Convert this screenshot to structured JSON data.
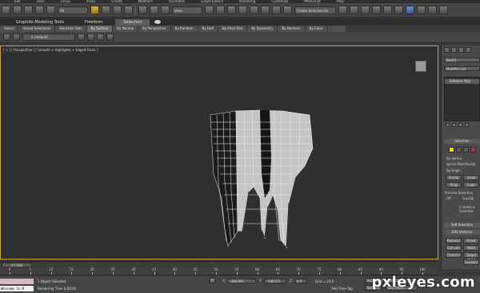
{
  "menu": [
    "Edit",
    "Tools",
    "Group",
    "Views",
    "Create",
    "Modifiers",
    "Animation",
    "Graph Editors",
    "Rendering",
    "Customize",
    "MAXScript",
    "Help"
  ],
  "toolbar": {
    "view_dropdown": "View",
    "selection_set": "Create Selection Se"
  },
  "ribbon": {
    "tabs": [
      "Graphite Modeling Tools",
      "Freeform",
      "Selection"
    ],
    "active_tab": 2,
    "buttons": [
      "Select",
      "Stored Selections",
      "Selection Sets",
      "By Surface",
      "By Normal",
      "By Perspective",
      "By Random",
      "By Half",
      "By Pivot Dist",
      "By Symmetry",
      "By Numeric",
      "By Color"
    ]
  },
  "layer": {
    "current": "0 (default)"
  },
  "viewport": {
    "label": "[ + ] [ Perspective ] [ Smooth + Highlights + Edged Faces ]",
    "object": "tooth-mesh"
  },
  "command_panel": {
    "object_name": "Box01",
    "modifier_list": "Modifier List",
    "stack_item": "Editable Poly",
    "selection_rollout": "Selection",
    "by_vertex": "By Vertex",
    "ignore_backfacing": "Ignore Backfacing",
    "by_angle": "By Angle:",
    "shrink": "Shrink",
    "grow": "Grow",
    "ring": "Ring",
    "loop": "Loop",
    "preview_selection": "Preview Selection",
    "off": "Off",
    "subobj": "SubObj",
    "vertices_selected": "0 Vertices Selected",
    "soft_selection": "Soft Selection",
    "edit_vertices": "Edit Vertices",
    "remove": "Remove",
    "break": "Break",
    "extrude": "Extrude",
    "weld": "Weld",
    "chamfer": "Chamfer",
    "target_weld": "Target Weld",
    "connect": "Connect"
  },
  "timeline": {
    "slider": "0 / 100",
    "ticks": [
      "0",
      "5",
      "10",
      "15",
      "20",
      "25",
      "30",
      "35",
      "40",
      "45",
      "50",
      "55",
      "60",
      "65",
      "70",
      "75",
      "80",
      "85",
      "90",
      "95",
      "100"
    ]
  },
  "status": {
    "maxscript": "Welcome to M",
    "selected": "1 Object Selected",
    "render_time": "Rendering Time 0:00:00",
    "x_label": "X:",
    "x": "-386.901",
    "y_label": "Y:",
    "y": "-198.571",
    "z_label": "Z:",
    "z": "0.0",
    "grid": "Grid = 10.0",
    "autokey": "Auto Key",
    "selected_dd": "Selected",
    "setkey": "Set Key",
    "key_filters": "Key Filters...",
    "add_time_tag": "Add Time Tag"
  },
  "watermark": "pxleyes.com"
}
